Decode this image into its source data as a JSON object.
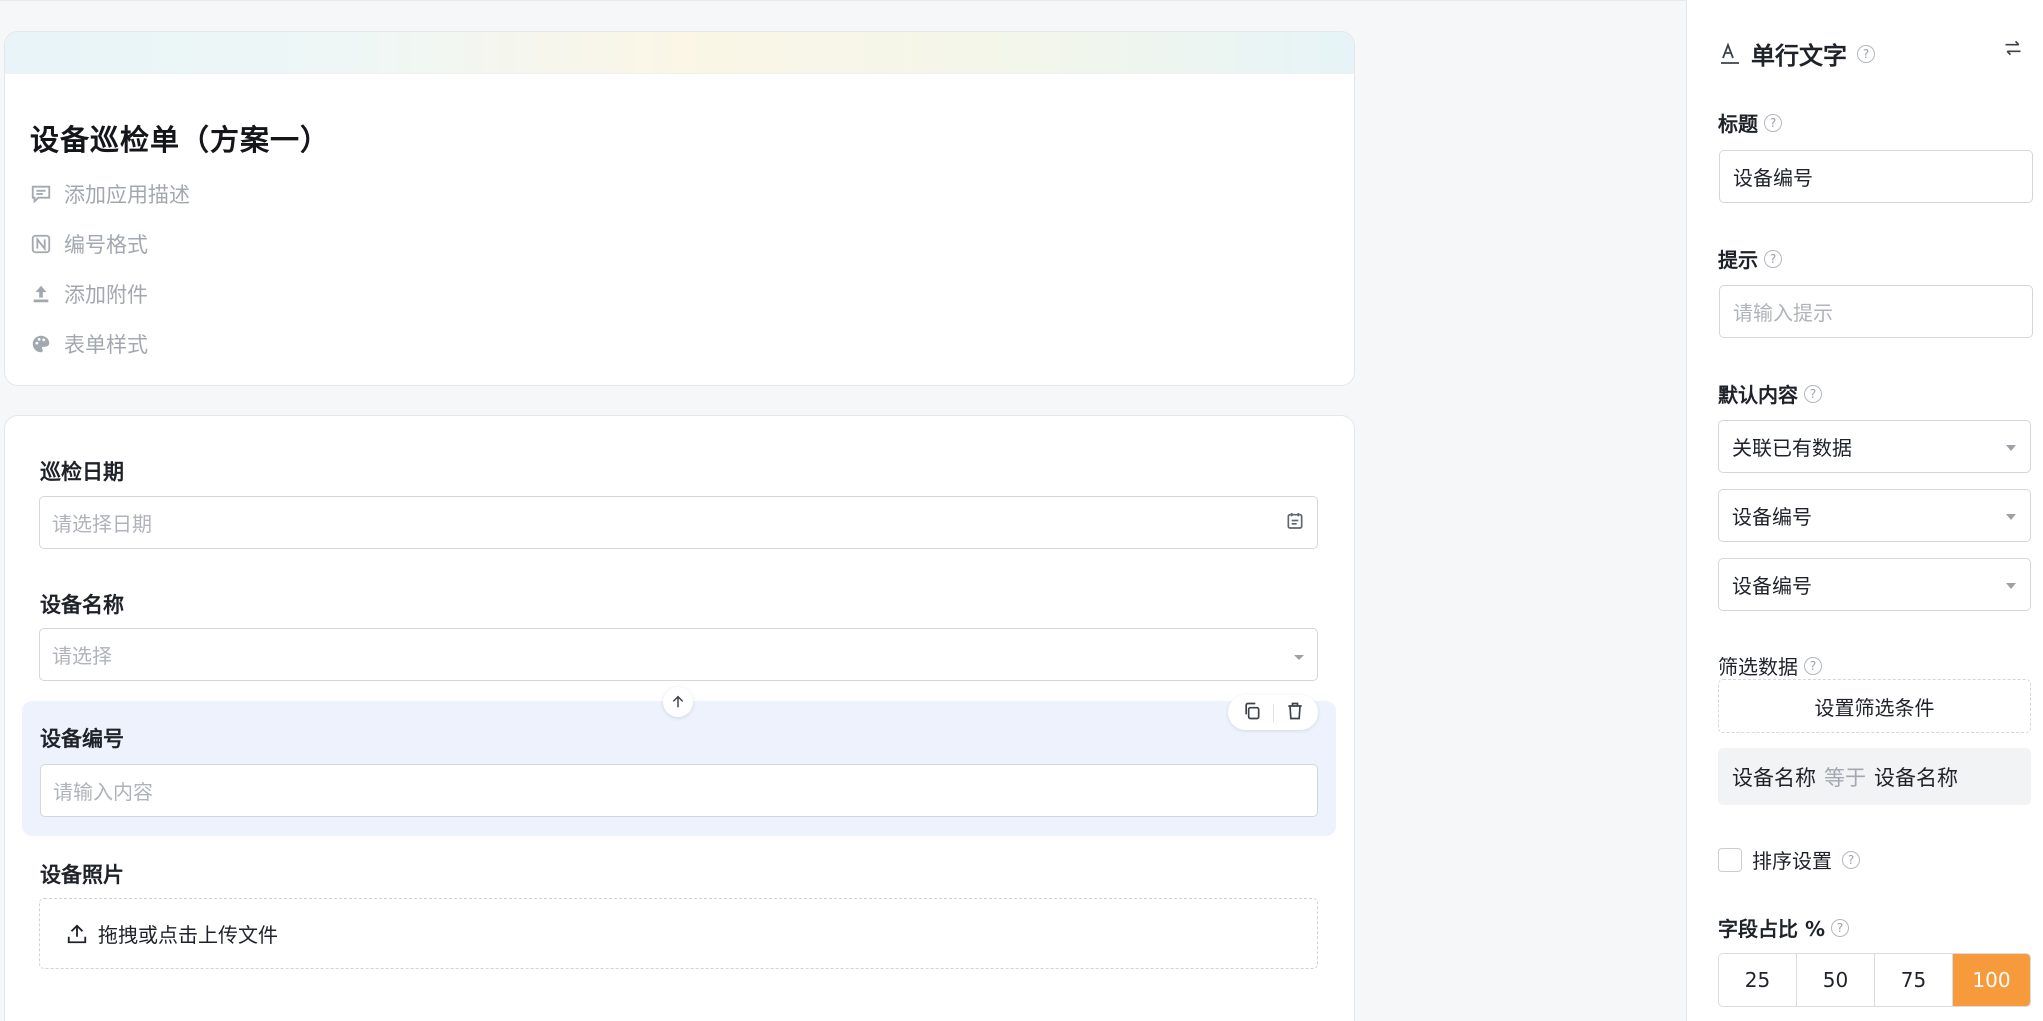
{
  "form": {
    "title": "设备巡检单（方案一）",
    "meta": {
      "description": "添加应用描述",
      "numbering": "编号格式",
      "attachment": "添加附件",
      "style": "表单样式"
    },
    "fields": [
      {
        "label": "巡检日期",
        "placeholder": "请选择日期"
      },
      {
        "label": "设备名称",
        "placeholder": "请选择"
      },
      {
        "label": "设备编号",
        "placeholder": "请输入内容"
      },
      {
        "label": "设备照片",
        "upload_text": "拖拽或点击上传文件"
      }
    ]
  },
  "panel": {
    "type_title": "单行文字",
    "title_label": "标题",
    "title_value": "设备编号",
    "hint_label": "提示",
    "hint_placeholder": "请输入提示",
    "default_label": "默认内容",
    "default_mode": "关联已有数据",
    "source_field_1": "设备编号",
    "source_field_2": "设备编号",
    "filter_label": "筛选数据",
    "filter_button": "设置筛选条件",
    "filter_condition": {
      "left": "设备名称",
      "op": "等于",
      "right": "设备名称"
    },
    "sort_label": "排序设置",
    "ratio_label": "字段占比 %",
    "ratio_options": [
      "25",
      "50",
      "75",
      "100"
    ],
    "ratio_selected": "100",
    "accent_color": "#f79a3b"
  }
}
